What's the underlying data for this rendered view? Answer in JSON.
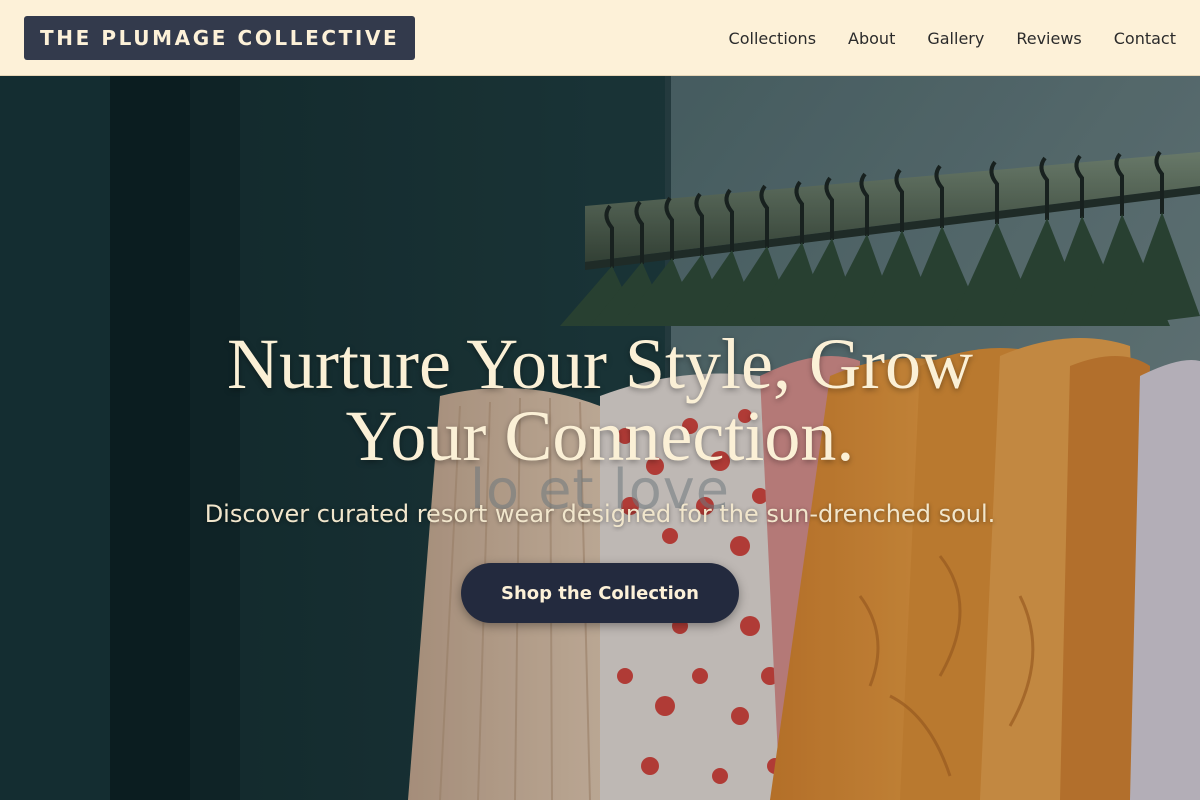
{
  "brand": {
    "name": "THE PLUMAGE COLLECTIVE"
  },
  "nav": {
    "items": [
      {
        "label": "Collections"
      },
      {
        "label": "About"
      },
      {
        "label": "Gallery"
      },
      {
        "label": "Reviews"
      },
      {
        "label": "Contact"
      }
    ]
  },
  "hero": {
    "headline": "Nurture Your Style, Grow Your Connection.",
    "background_text": "lo   et love",
    "subheadline": "Discover curated resort wear designed for the sun-drenched soul.",
    "cta_label": "Shop the Collection",
    "photo_icon": "clothing-rack-photo"
  },
  "colors": {
    "header_bg": "#fdf1d8",
    "brand_bg": "#333a4c",
    "headline": "#fbf0d6",
    "cta_bg": "#232a3e",
    "cta_text": "#fdf1d8"
  }
}
